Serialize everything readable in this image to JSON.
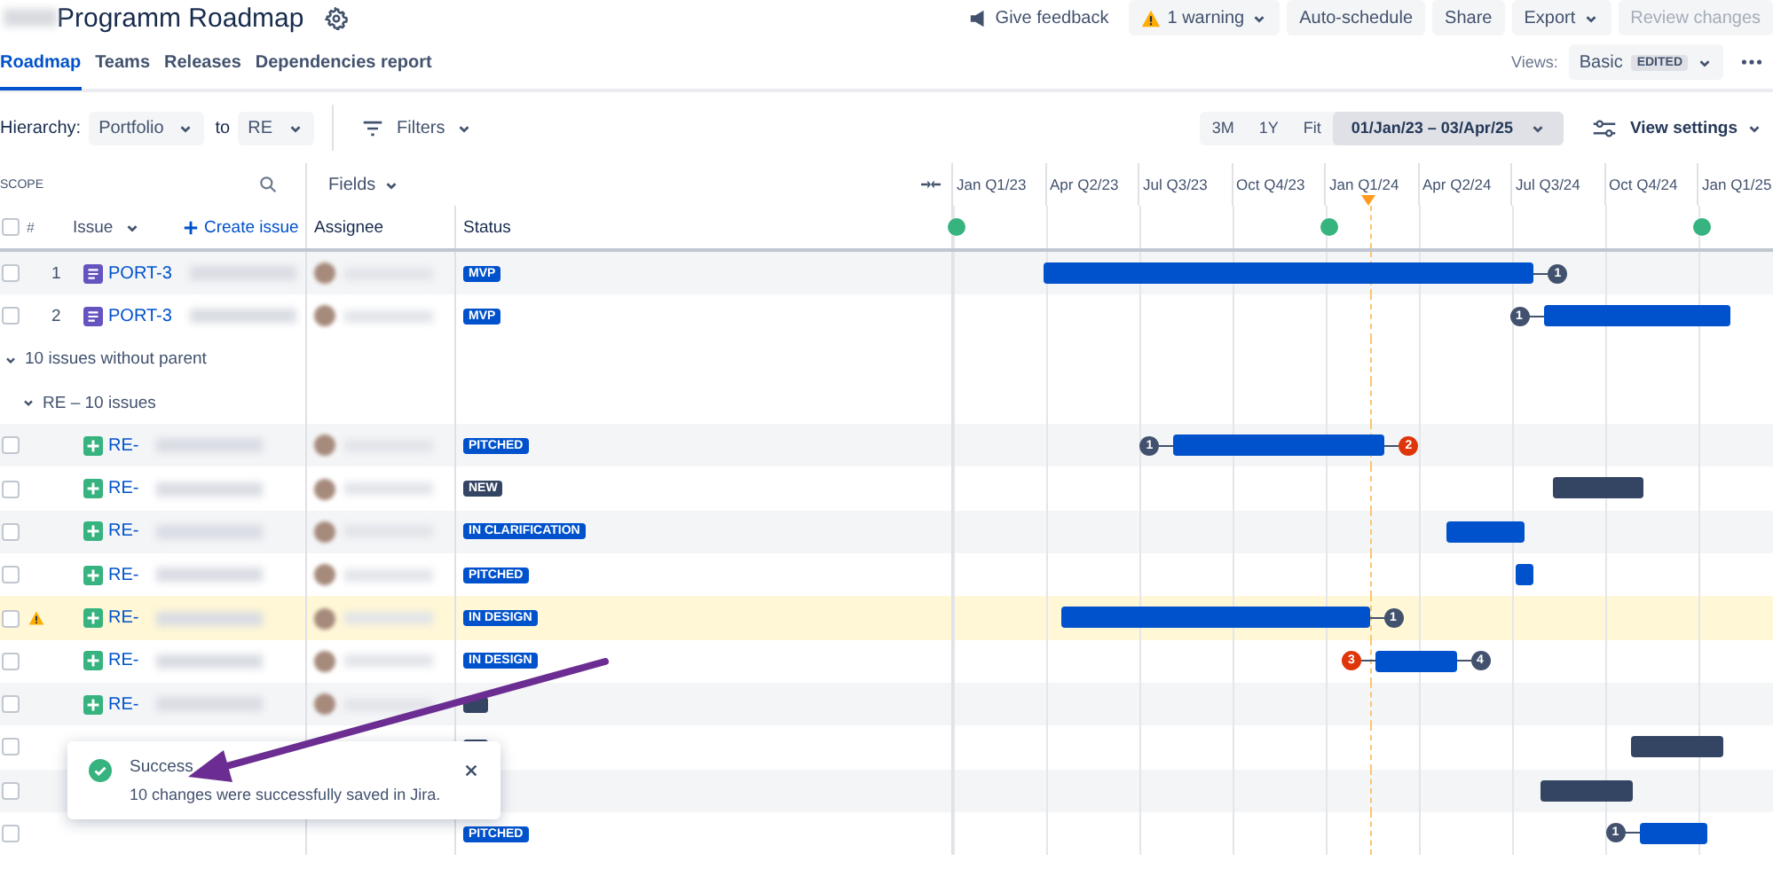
{
  "header": {
    "title": "Programm Roadmap",
    "actions": [
      {
        "label": "Give feedback",
        "kind": "feedback"
      },
      {
        "label": "1 warning",
        "kind": "warning"
      },
      {
        "label": "Auto-schedule",
        "kind": "plain"
      },
      {
        "label": "Share",
        "kind": "plain"
      },
      {
        "label": "Export",
        "kind": "menu"
      },
      {
        "label": "Review changes",
        "kind": "disabled"
      }
    ]
  },
  "tabs": [
    {
      "label": "Roadmap",
      "selected": true
    },
    {
      "label": "Teams",
      "selected": false
    },
    {
      "label": "Releases",
      "selected": false
    },
    {
      "label": "Dependencies report",
      "selected": false
    }
  ],
  "views": {
    "label": "Views:",
    "value": "Basic",
    "badge": "EDITED"
  },
  "toolbar": {
    "hierarchy_label": "Hierarchy:",
    "from": "Portfolio",
    "to_label": "to",
    "to": "RE",
    "filters": "Filters",
    "ranges": [
      {
        "label": "3M",
        "selected": false
      },
      {
        "label": "1Y",
        "selected": false
      },
      {
        "label": "Fit",
        "selected": false
      },
      {
        "label": "01/Jan/23 – 03/Apr/25",
        "selected": true
      }
    ],
    "view_settings": "View settings"
  },
  "columns": {
    "scope": "SCOPE",
    "fields": "Fields",
    "select_all": {
      "checked": false
    },
    "number": "#",
    "issue": "Issue",
    "create": "Create issue",
    "assignee": "Assignee",
    "status": "Status"
  },
  "timeline": {
    "quarters": [
      "Jan Q1/23",
      "Apr Q2/23",
      "Jul Q3/23",
      "Oct Q4/23",
      "Jan Q1/24",
      "Apr Q2/24",
      "Jul Q3/24",
      "Oct Q4/24",
      "Jan Q1/25"
    ]
  },
  "rows": [
    {
      "kind": "epic",
      "checked": false,
      "number": "1",
      "key": "PORT-3",
      "status": {
        "label": "MVP",
        "kind": "progress"
      },
      "warning": false,
      "deps": [
        {
          "label": "1",
          "kind": "after",
          "conflict": false
        }
      ]
    },
    {
      "kind": "epic",
      "checked": false,
      "number": "2",
      "key": "PORT-3",
      "status": {
        "label": "MVP",
        "kind": "progress"
      },
      "warning": false,
      "deps": [
        {
          "label": "1",
          "kind": "before",
          "conflict": false
        }
      ]
    },
    {
      "kind": "group",
      "label": "10 issues without parent",
      "expanded": true,
      "children": [
        {
          "kind": "group",
          "label": "RE – 10 issues",
          "expanded": true,
          "children": [
            {
              "kind": "story",
              "checked": false,
              "key": "RE-",
              "status": {
                "label": "PITCHED",
                "kind": "progress"
              },
              "warning": false,
              "deps": [
                {
                  "label": "1",
                  "kind": "before",
                  "conflict": false
                },
                {
                  "label": "2",
                  "kind": "after",
                  "conflict": true
                }
              ]
            },
            {
              "kind": "story",
              "checked": false,
              "key": "RE-",
              "status": {
                "label": "NEW",
                "kind": "new"
              },
              "warning": false
            },
            {
              "kind": "story",
              "checked": false,
              "key": "RE-",
              "status": {
                "label": "IN CLARIFICATION",
                "kind": "progress"
              },
              "warning": false
            },
            {
              "kind": "story",
              "checked": false,
              "key": "RE-",
              "status": {
                "label": "PITCHED",
                "kind": "progress"
              },
              "warning": false
            },
            {
              "kind": "story",
              "checked": false,
              "key": "RE-",
              "status": {
                "label": "IN DESIGN",
                "kind": "progress"
              },
              "warning": true,
              "deps": [
                {
                  "label": "1",
                  "kind": "after",
                  "conflict": false
                }
              ]
            },
            {
              "kind": "story",
              "checked": false,
              "key": "RE-",
              "status": {
                "label": "IN DESIGN",
                "kind": "progress"
              },
              "warning": false,
              "deps": [
                {
                  "label": "3",
                  "kind": "before",
                  "conflict": true
                },
                {
                  "label": "4",
                  "kind": "after",
                  "conflict": false
                }
              ]
            },
            {
              "kind": "story",
              "checked": false,
              "key": "RE-",
              "status": {
                "kind": "new"
              },
              "warning": false
            },
            {
              "kind": "hidden",
              "checked": false,
              "status": {
                "kind": "new"
              },
              "warning": false
            },
            {
              "kind": "hidden",
              "checked": false,
              "warning": false
            },
            {
              "kind": "hidden",
              "checked": false,
              "status": {
                "label": "PITCHED",
                "kind": "progress"
              },
              "warning": false,
              "deps": [
                {
                  "label": "1",
                  "kind": "before",
                  "conflict": false
                }
              ]
            }
          ]
        }
      ]
    }
  ],
  "toast": {
    "title": "Success",
    "message": "10 changes were successfully saved in Jira."
  }
}
